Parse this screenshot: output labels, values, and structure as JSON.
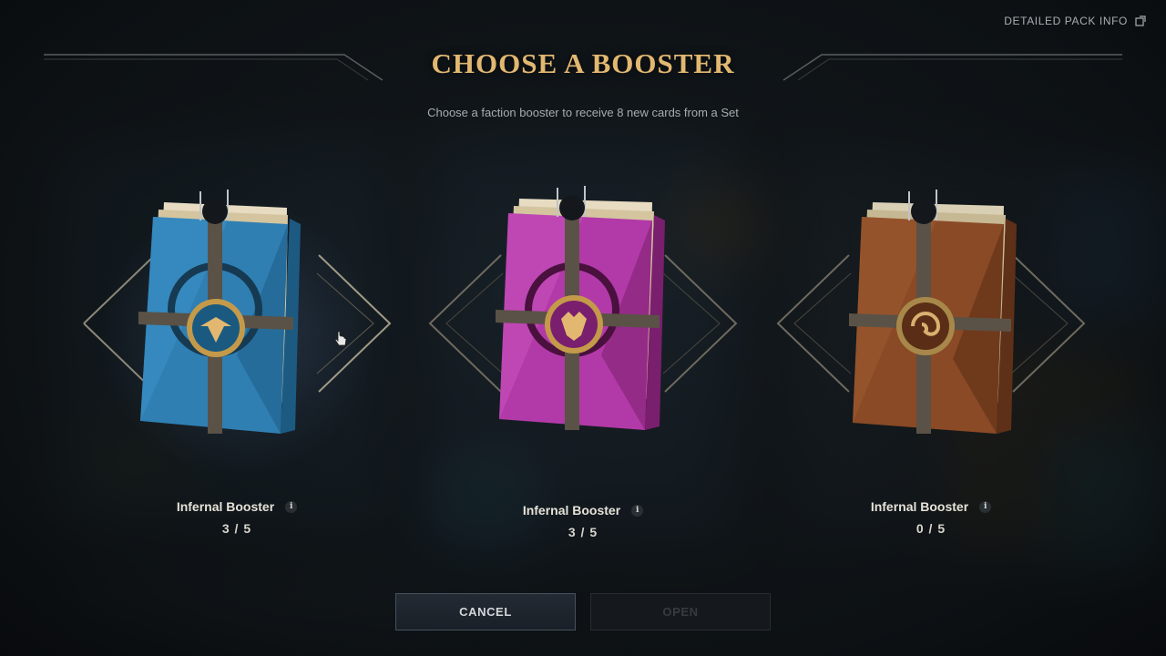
{
  "header": {
    "detail_link": "DETAILED PACK INFO",
    "title": "CHOOSE A BOOSTER",
    "subtitle": "Choose a faction booster to receive 8 new cards from a Set"
  },
  "packs": [
    {
      "name": "Infernal Booster",
      "count": "3 / 5",
      "color": "#2f7fb3",
      "emblem": "winged-crest-icon",
      "selected": true
    },
    {
      "name": "Infernal Booster",
      "count": "3 / 5",
      "color": "#b23aa8",
      "emblem": "horned-crest-icon",
      "selected": false
    },
    {
      "name": "Infernal Booster",
      "count": "0 / 5",
      "color": "#8a4a25",
      "emblem": "swirl-crest-icon",
      "selected": false
    }
  ],
  "buttons": {
    "cancel": "CANCEL",
    "open": "OPEN"
  },
  "colors": {
    "accent_gold": "#e2b871",
    "background": "#11161a"
  }
}
